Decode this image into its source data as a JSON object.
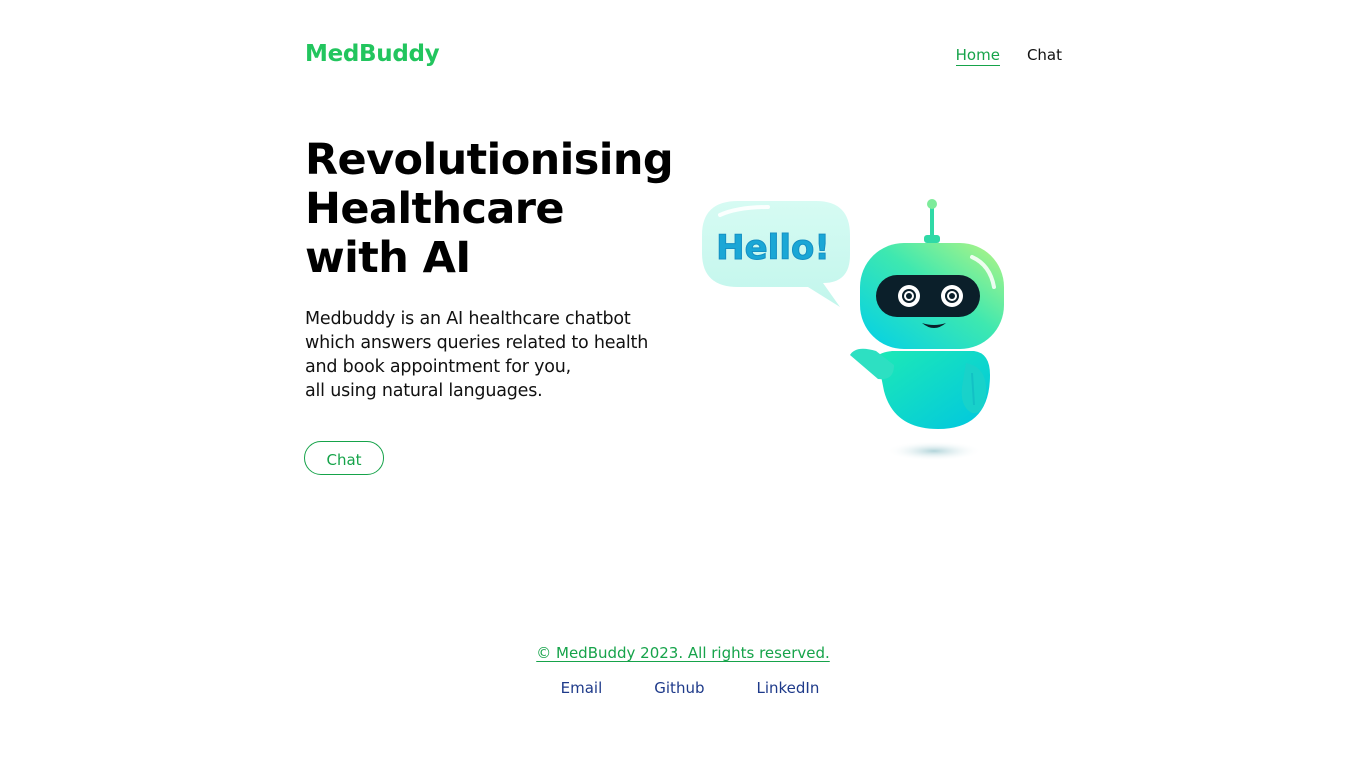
{
  "header": {
    "brand": "MedBuddy",
    "nav": [
      {
        "label": "Home",
        "active": true
      },
      {
        "label": "Chat",
        "active": false
      }
    ]
  },
  "hero": {
    "title_lines": [
      "Revolutionising",
      "Healthcare",
      "with AI"
    ],
    "description_lines": [
      "Medbuddy is an AI healthcare chatbot",
      "which answers queries related to health",
      "and book appointment for you,",
      "all using natural languages."
    ],
    "cta_label": "Chat",
    "illustration": {
      "speech_bubble_text": "Hello!",
      "icon": "robot-illustration"
    }
  },
  "footer": {
    "copyright": "© MedBuddy 2023. All rights reserved.",
    "links": [
      "Email",
      "Github",
      "LinkedIn"
    ]
  },
  "colors": {
    "brand": "#22c55e",
    "accent": "#16a34a",
    "footer_link": "#1e3a8a",
    "robot_gradient": [
      "#a3f07a",
      "#1de9b6",
      "#00c6e0"
    ]
  }
}
